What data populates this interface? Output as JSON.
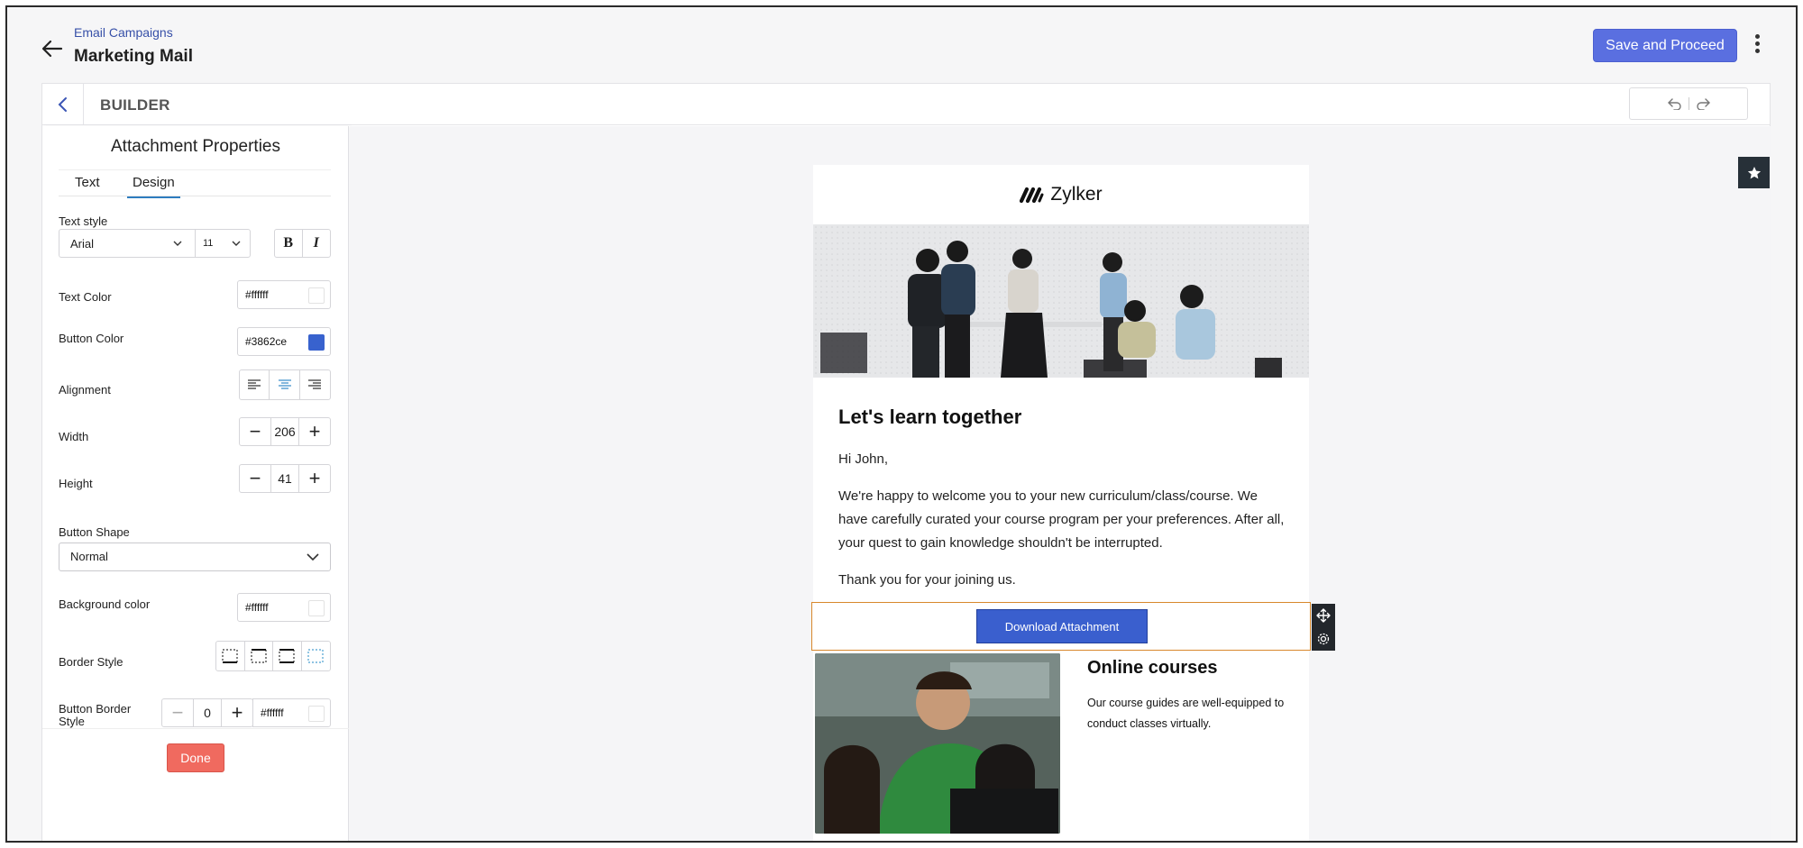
{
  "header": {
    "breadcrumb": "Email Campaigns",
    "title": "Marketing Mail",
    "save_label": "Save and Proceed"
  },
  "builder": {
    "title": "BUILDER"
  },
  "panel": {
    "title": "Attachment Properties",
    "tabs": [
      {
        "label": "Text",
        "active": false
      },
      {
        "label": "Design",
        "active": true
      }
    ],
    "text_style_label": "Text style",
    "font_family": "Arial",
    "font_size": "11",
    "bold_label": "B",
    "italic_label": "I",
    "text_color_label": "Text Color",
    "text_color_value": "#ffffff",
    "button_color_label": "Button Color",
    "button_color_value": "#3862ce",
    "alignment_label": "Alignment",
    "width_label": "Width",
    "width_value": "206",
    "height_label": "Height",
    "height_value": "41",
    "button_shape_label": "Button Shape",
    "button_shape_value": "Normal",
    "background_color_label": "Background color",
    "background_color_value": "#ffffff",
    "border_style_label": "Border Style",
    "button_border_label": "Button Border Style",
    "button_border_width": "0",
    "button_border_color": "#ffffff",
    "done_label": "Done"
  },
  "email": {
    "brand": "Zylker",
    "heading": "Let's learn together",
    "greeting": "Hi John,",
    "body": "We're happy to welcome you to your new curriculum/class/course. We have carefully curated your course program per your preferences. After all, your quest to gain knowledge shouldn't be interrupted.",
    "thanks": "Thank you for your joining us.",
    "button_label": "Download Attachment",
    "section_title": "Online courses",
    "section_text": "Our course guides are well-equipped to conduct classes virtually."
  },
  "icons": {
    "back": "arrow-left-icon",
    "kebab": "more-vertical-icon",
    "undo": "undo-icon",
    "redo": "redo-icon",
    "move": "move-icon",
    "settings": "gear-icon",
    "star": "star-icon"
  },
  "colors": {
    "primary": "#5a6fe0",
    "button": "#3862ce",
    "done": "#f06a5f",
    "selection": "#d8882c"
  }
}
